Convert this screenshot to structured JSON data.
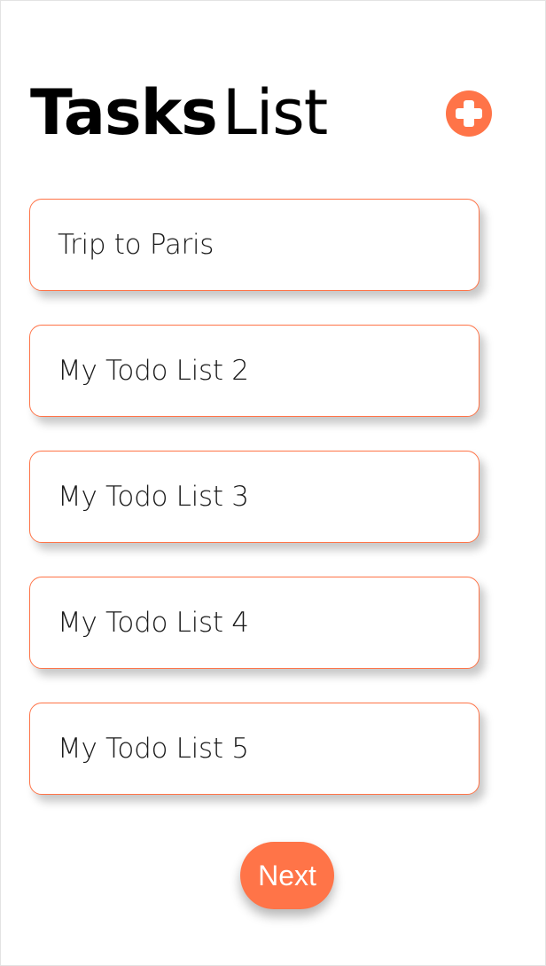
{
  "header": {
    "title_bold": "Tasks",
    "title_light": "List"
  },
  "add_button": {
    "icon": "plus-circle-icon"
  },
  "lists": [
    {
      "label": "Trip to Paris"
    },
    {
      "label": "My Todo List 2"
    },
    {
      "label": "My Todo List 3"
    },
    {
      "label": "My Todo List 4"
    },
    {
      "label": "My Todo List 5"
    }
  ],
  "footer": {
    "next_label": "Next"
  },
  "colors": {
    "accent": "#ff7448",
    "background": "#ffffff",
    "text": "#000000"
  }
}
